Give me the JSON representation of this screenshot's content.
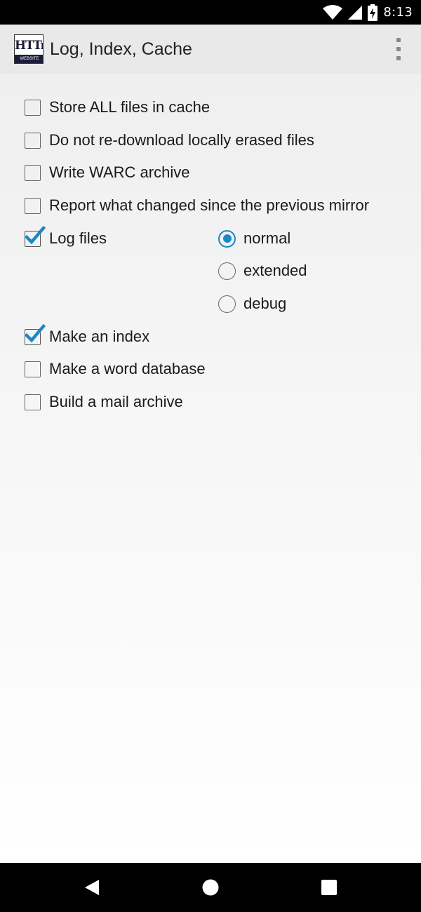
{
  "status_bar": {
    "time": "8:13",
    "icons": [
      "wifi-icon",
      "cellular-signal-icon",
      "battery-charging-icon"
    ]
  },
  "app_bar": {
    "logo": {
      "top": "HTTrack",
      "bottom": "WEBSITE COPIER"
    },
    "title": "Log, Index, Cache",
    "overflow_icon": "more-vert-icon"
  },
  "options": {
    "store_all_files": {
      "label": "Store ALL files in cache",
      "checked": false
    },
    "no_redownload": {
      "label": "Do not re-download locally erased files",
      "checked": false
    },
    "write_warc": {
      "label": "Write WARC archive",
      "checked": false
    },
    "report_changes": {
      "label": "Report what changed since the previous mirror",
      "checked": false
    },
    "log_files": {
      "label": "Log files",
      "checked": true
    },
    "make_index": {
      "label": "Make an index",
      "checked": true
    },
    "word_database": {
      "label": "Make a word database",
      "checked": false
    },
    "mail_archive": {
      "label": "Build a mail archive",
      "checked": false
    }
  },
  "log_level": {
    "selected": "normal",
    "options": [
      {
        "label": "normal",
        "selected": true
      },
      {
        "label": "extended",
        "selected": false
      },
      {
        "label": "debug",
        "selected": false
      }
    ]
  },
  "nav_bar": {
    "back_icon": "back-triangle-icon",
    "home_icon": "home-circle-icon",
    "recents_icon": "recents-square-icon"
  },
  "colors": {
    "accent": "#1e88c7",
    "app_bar": "#e9e9e9",
    "status_bar": "#000000"
  }
}
